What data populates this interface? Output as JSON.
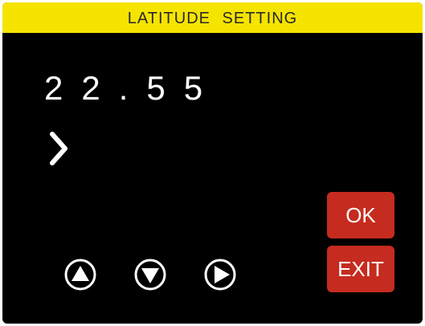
{
  "header": {
    "title": "LATITUDE  SETTING"
  },
  "display": {
    "value": "22.55"
  },
  "buttons": {
    "ok_label": "OK",
    "exit_label": "EXIT"
  },
  "icons": {
    "cursor": "chevron-right-icon",
    "up": "arrow-up-icon",
    "down": "arrow-down-icon",
    "right": "arrow-right-icon"
  },
  "colors": {
    "title_bar": "#f5e400",
    "background": "#000000",
    "button_red": "#c62b1f",
    "text": "#ffffff"
  }
}
